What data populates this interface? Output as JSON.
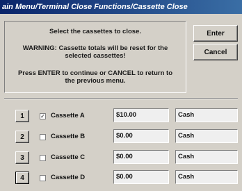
{
  "window": {
    "title": "ain Menu/Terminal Close Functions/Cassette Close"
  },
  "message": {
    "line1": "Select the cassettes to close.",
    "line2": "WARNING: Cassette totals will be reset for the",
    "line3": "selected cassettes!",
    "line4": "Press ENTER to continue or CANCEL to return to",
    "line5": "the previous menu."
  },
  "buttons": {
    "enter": "Enter",
    "cancel": "Cancel"
  },
  "cassettes": [
    {
      "number": "1",
      "checked": true,
      "check_glyph": "✓",
      "label": "Cassette A",
      "amount": "$10.00",
      "type": "Cash"
    },
    {
      "number": "2",
      "checked": false,
      "check_glyph": "",
      "label": "Cassette B",
      "amount": "$0.00",
      "type": "Cash"
    },
    {
      "number": "3",
      "checked": false,
      "check_glyph": "",
      "label": "Cassette C",
      "amount": "$0.00",
      "type": "Cash"
    },
    {
      "number": "4",
      "checked": false,
      "check_glyph": "",
      "label": "Cassette D",
      "amount": "$0.00",
      "type": "Cash"
    }
  ],
  "colors": {
    "title_start": "#0a246a",
    "title_end": "#3a6ea5",
    "face": "#d4d0c8"
  }
}
